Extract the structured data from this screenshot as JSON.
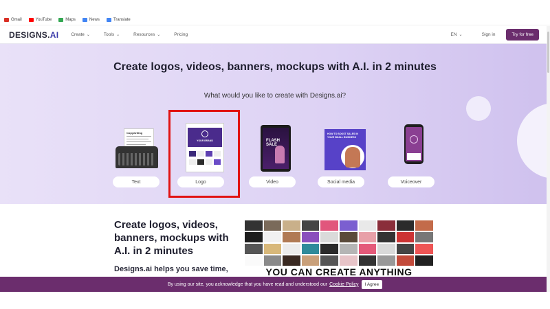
{
  "bookmarks": [
    {
      "label": "Gmail",
      "icon": "gmail-icon",
      "color": "#d93025"
    },
    {
      "label": "YouTube",
      "icon": "youtube-icon",
      "color": "#ff0000"
    },
    {
      "label": "Maps",
      "icon": "maps-icon",
      "color": "#34a853"
    },
    {
      "label": "News",
      "icon": "news-icon",
      "color": "#4285f4"
    },
    {
      "label": "Translate",
      "icon": "translate-icon",
      "color": "#4285f4"
    }
  ],
  "nav": {
    "logo_main": "DESIGNS.",
    "logo_ai": "AI",
    "links": [
      {
        "label": "Create",
        "dropdown": true
      },
      {
        "label": "Tools",
        "dropdown": true
      },
      {
        "label": "Resources",
        "dropdown": true
      },
      {
        "label": "Pricing",
        "dropdown": false
      }
    ],
    "lang": "EN",
    "signin": "Sign in",
    "cta": "Try for free",
    "cta_color": "#6b2d6d"
  },
  "hero": {
    "title": "Create logos, videos, banners, mockups with A.I. in 2 minutes",
    "subtitle": "What would you like to create with Designs.ai?",
    "categories": [
      {
        "label": "Text",
        "icon": "typewriter-icon"
      },
      {
        "label": "Logo",
        "icon": "logo-preview-icon",
        "selected": true
      },
      {
        "label": "Video",
        "icon": "tablet-video-icon"
      },
      {
        "label": "Social media",
        "icon": "social-post-icon"
      },
      {
        "label": "Voiceover",
        "icon": "phone-voiceover-icon"
      }
    ],
    "text_card": {
      "paper_title": "Copywriting"
    },
    "logo_card": {
      "brand_text": "YOUR BRAND"
    },
    "video_card": {
      "promo_text": "FLASH SALE"
    },
    "social_card": {
      "headline": "HOW TO BOOST SALES IN YOUR SMALL BUSINESS"
    }
  },
  "lower": {
    "title": "Create logos, videos, banners, mockups with A.I. in 2 minutes",
    "desc": "Designs.ai helps you save time,",
    "collage_text": "YOU CAN CREATE ANYTHING"
  },
  "cookie": {
    "text": "By using our site, you acknowledge that you have read and understood our",
    "link": "Cookie Policy",
    "button": "I Agree"
  }
}
